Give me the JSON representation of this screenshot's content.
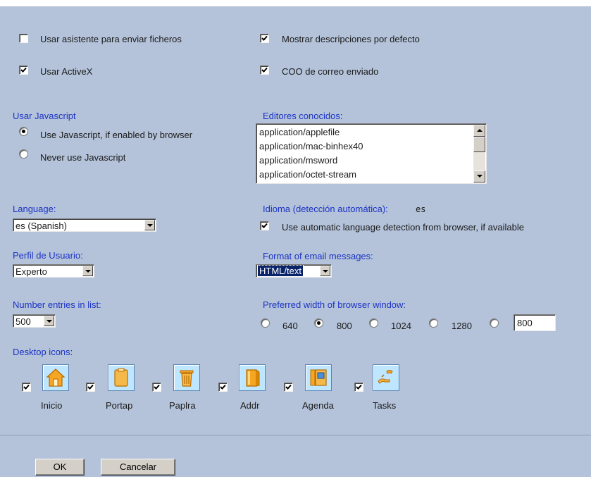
{
  "options": {
    "wizard_label": "Usar asistente para enviar ficheros",
    "wizard_checked": false,
    "activex_label": "Usar ActiveX",
    "activex_checked": true,
    "descriptions_label": "Mostrar descripciones por defecto",
    "descriptions_checked": true,
    "coo_label": "COO de correo enviado",
    "coo_checked": true
  },
  "javascript": {
    "heading": "Usar Javascript",
    "options": [
      {
        "label": "Use Javascript, if enabled by browser",
        "selected": true
      },
      {
        "label": "Never use Javascript",
        "selected": false
      }
    ]
  },
  "editors": {
    "heading": "Editores conocidos:",
    "items": [
      "application/applefile",
      "application/mac-binhex40",
      "application/msword",
      "application/octet-stream"
    ]
  },
  "language": {
    "heading": "Language:",
    "selected": "es (Spanish)"
  },
  "idioma": {
    "heading": "Idioma (detección automática):",
    "value": "es",
    "auto_label": "Use automatic language detection from browser, if available",
    "auto_checked": true
  },
  "profile": {
    "heading": "Perfil de Usuario:",
    "selected": "Experto"
  },
  "email_format": {
    "heading": "Format of email messages:",
    "selected": "HTML/text"
  },
  "entries": {
    "heading": "Number entries in list:",
    "selected": "500"
  },
  "browser_width": {
    "heading": "Preferred width of browser window:",
    "options": [
      {
        "label": "640",
        "selected": false
      },
      {
        "label": "800",
        "selected": true
      },
      {
        "label": "1024",
        "selected": false
      },
      {
        "label": "1280",
        "selected": false
      }
    ],
    "custom_value": "800"
  },
  "desktop": {
    "heading": "Desktop icons:",
    "icons": [
      {
        "label": "Inicio",
        "icon": "home-icon",
        "checked": true
      },
      {
        "label": "Portap",
        "icon": "clipboard-icon",
        "checked": true
      },
      {
        "label": "Paplra",
        "icon": "trash-icon",
        "checked": true
      },
      {
        "label": "Addr",
        "icon": "address-book-icon",
        "checked": true
      },
      {
        "label": "Agenda",
        "icon": "agenda-icon",
        "checked": true
      },
      {
        "label": "Tasks",
        "icon": "tasks-icon",
        "checked": true
      }
    ]
  },
  "buttons": {
    "ok": "OK",
    "cancel": "Cancelar"
  }
}
